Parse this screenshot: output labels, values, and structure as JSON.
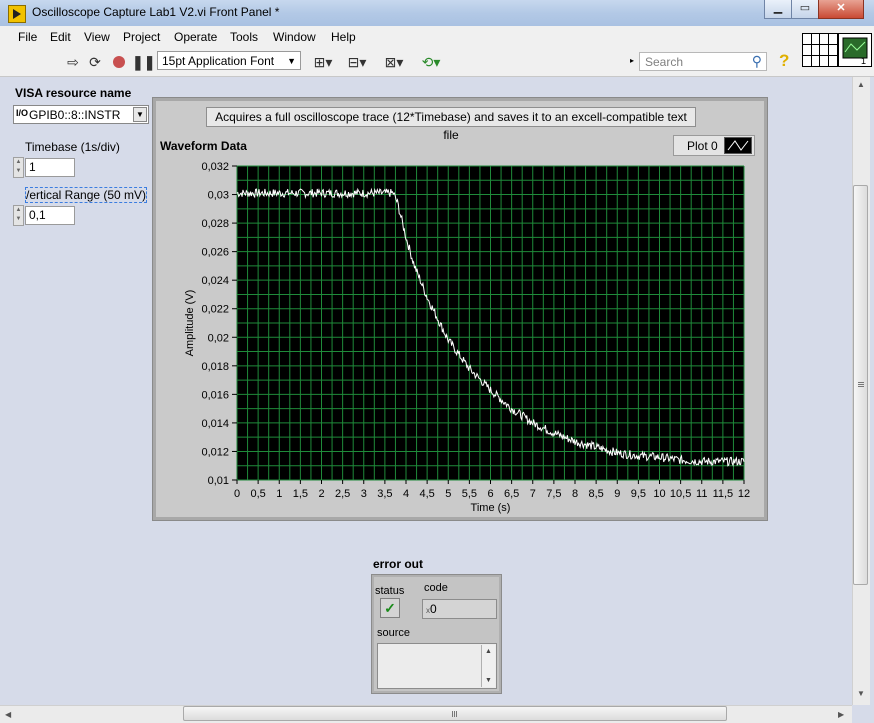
{
  "window": {
    "title": "Oscilloscope Capture Lab1 V2.vi Front Panel *",
    "controls": {
      "minimize": "▁",
      "maximize": "▭",
      "close": "✕"
    }
  },
  "menu": [
    "File",
    "Edit",
    "View",
    "Project",
    "Operate",
    "Tools",
    "Window",
    "Help"
  ],
  "toolbar": {
    "font": "15pt Application Font",
    "search_placeholder": "Search",
    "help_symbol": "?",
    "icons": [
      "run-arrow-icon",
      "run-continuously-icon",
      "abort-icon",
      "pause-icon",
      "align-icon",
      "distribute-icon",
      "resize-icon",
      "reorder-icon"
    ]
  },
  "visa": {
    "label": "VISA resource name",
    "io_glyph": "I/O",
    "value": "GPIB0::8::INSTR"
  },
  "timebase": {
    "label": "Timebase (1s/div)",
    "value": "1"
  },
  "vrange": {
    "label": "/ertical Range (50 mV)",
    "value": "0,1"
  },
  "description": "Acquires a full oscilloscope trace (12*Timebase) and saves it to an excell-compatible text file",
  "chart_data": {
    "type": "line",
    "title": "Waveform Data",
    "xlabel": "Time (s)",
    "ylabel": "Amplitude (V)",
    "xlim": [
      0,
      12
    ],
    "ylim": [
      0.01,
      0.032
    ],
    "x_ticks": [
      "0",
      "0,5",
      "1",
      "1,5",
      "2",
      "2,5",
      "3",
      "3,5",
      "4",
      "4,5",
      "5",
      "5,5",
      "6",
      "6,5",
      "7",
      "7,5",
      "8",
      "8,5",
      "9",
      "9,5",
      "10",
      "10,5",
      "11",
      "11,5",
      "12"
    ],
    "y_ticks": [
      "0,01",
      "0,012",
      "0,014",
      "0,016",
      "0,018",
      "0,02",
      "0,022",
      "0,024",
      "0,026",
      "0,028",
      "0,03",
      "0,032"
    ],
    "grid": true,
    "legend_position": "top-right",
    "series": [
      {
        "name": "Plot 0",
        "color": "#ffffff",
        "x": [
          0,
          1,
          2,
          3,
          3.7,
          3.8,
          4,
          4.2,
          4.5,
          5,
          5.5,
          6,
          6.5,
          7,
          7.5,
          8,
          8.5,
          9,
          9.5,
          10,
          10.5,
          11,
          11.5,
          12
        ],
        "y": [
          0.0301,
          0.0301,
          0.0301,
          0.0301,
          0.0301,
          0.0294,
          0.027,
          0.025,
          0.0228,
          0.0198,
          0.0178,
          0.0163,
          0.015,
          0.014,
          0.0133,
          0.0127,
          0.0123,
          0.0119,
          0.0117,
          0.0116,
          0.0114,
          0.0113,
          0.0113,
          0.0113
        ]
      }
    ]
  },
  "error_out": {
    "label": "error out",
    "status_label": "status",
    "status_glyph": "✓",
    "code_label": "code",
    "code_prefix": "x",
    "code_value": "0",
    "source_label": "source",
    "source_value": ""
  },
  "colors": {
    "plot_bg": "#000000",
    "grid": "#1f8a3a",
    "trace": "#ffffff"
  }
}
